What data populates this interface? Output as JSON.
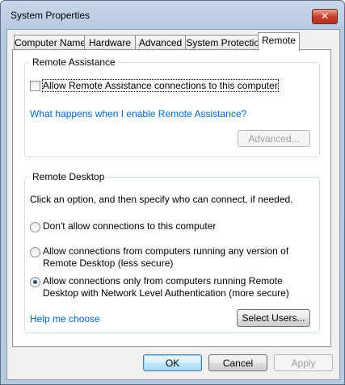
{
  "window": {
    "title": "System Properties",
    "close_glyph": "✕"
  },
  "tabs": [
    {
      "label": "Computer Name"
    },
    {
      "label": "Hardware"
    },
    {
      "label": "Advanced"
    },
    {
      "label": "System Protection"
    },
    {
      "label": "Remote",
      "selected": true
    }
  ],
  "remote_assistance": {
    "group_title": "Remote Assistance",
    "allow_label": "Allow Remote Assistance connections to this computer",
    "allow_checked": false,
    "help_link": "What happens when I enable Remote Assistance?",
    "advanced_button": "Advanced..."
  },
  "remote_desktop": {
    "group_title": "Remote Desktop",
    "instruction": "Click an option, and then specify who can connect, if needed.",
    "options": [
      {
        "line1": "Don't allow connections to this computer",
        "line2": "",
        "selected": false
      },
      {
        "line1": "Allow connections from computers running any version of",
        "line2": "Remote Desktop (less secure)",
        "selected": false
      },
      {
        "line1": "Allow connections only from computers running Remote",
        "line2": "Desktop with Network Level Authentication (more secure)",
        "selected": true
      }
    ],
    "help_link": "Help me choose",
    "select_users_button": "Select Users..."
  },
  "footer": {
    "ok": "OK",
    "cancel": "Cancel",
    "apply": "Apply"
  },
  "colors": {
    "link": "#0066cc",
    "title_bar": "#b5c8e0",
    "close_button": "#c7402d"
  }
}
